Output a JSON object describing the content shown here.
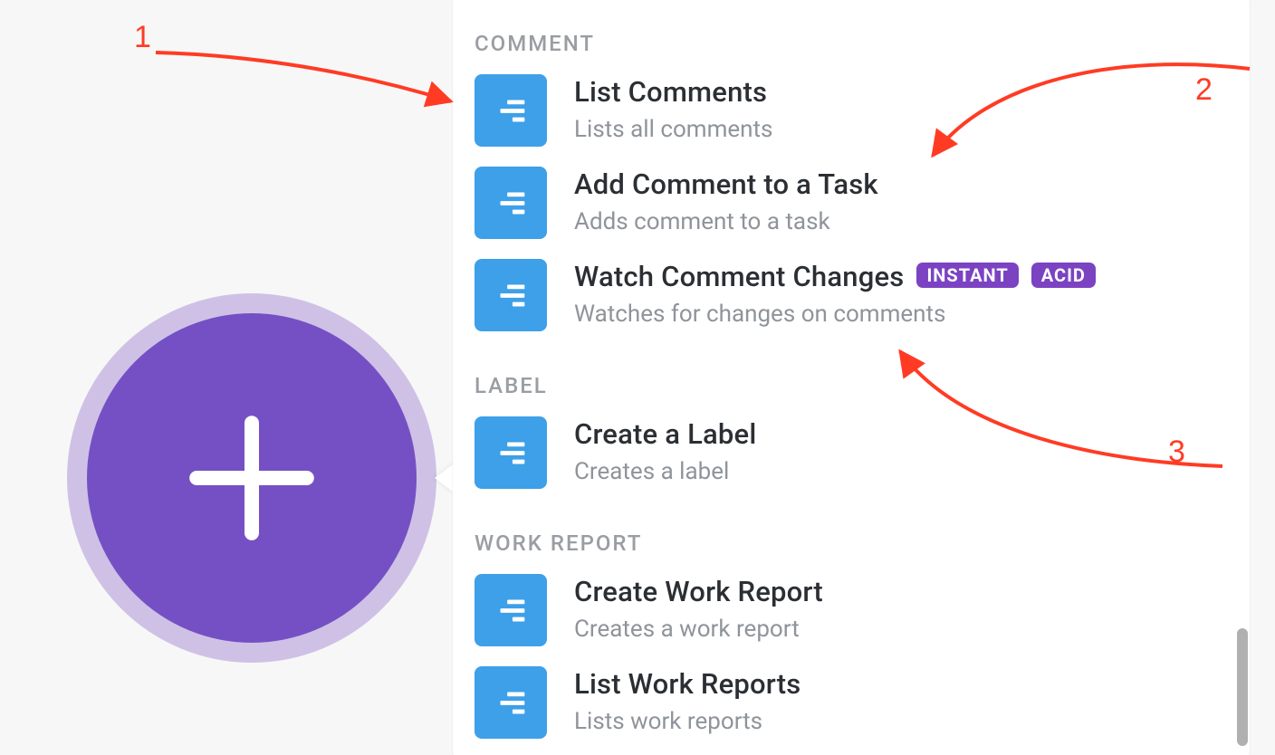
{
  "colors": {
    "accent_purple": "#7550c4",
    "accent_purple_light": "#cfc1e6",
    "badge_purple": "#7b43c2",
    "module_blue": "#3da0e8",
    "text_primary": "#2b2f33",
    "text_muted": "#8f949a",
    "annotation_red": "#ff3b24"
  },
  "add_button": {
    "icon": "plus-icon"
  },
  "panel": {
    "sections": [
      {
        "header": "COMMENT",
        "items": [
          {
            "title": "List Comments",
            "desc": "Lists all comments",
            "badges": []
          },
          {
            "title": "Add Comment to a Task",
            "desc": "Adds comment to a task",
            "badges": []
          },
          {
            "title": "Watch Comment Changes",
            "desc": "Watches for changes on comments",
            "badges": [
              "INSTANT",
              "ACID"
            ]
          }
        ]
      },
      {
        "header": "LABEL",
        "items": [
          {
            "title": "Create a Label",
            "desc": "Creates a label",
            "badges": []
          }
        ]
      },
      {
        "header": "WORK REPORT",
        "items": [
          {
            "title": "Create Work Report",
            "desc": "Creates a work report",
            "badges": []
          },
          {
            "title": "List Work Reports",
            "desc": "Lists work reports",
            "badges": []
          }
        ]
      }
    ]
  },
  "annotations": {
    "n1": "1",
    "n2": "2",
    "n3": "3"
  }
}
